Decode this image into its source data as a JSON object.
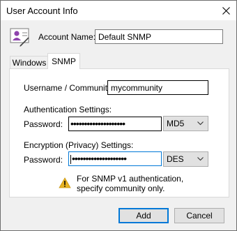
{
  "window": {
    "title": "User Account Info"
  },
  "account": {
    "name_label": "Account Name:",
    "name_value": "Default SNMP"
  },
  "tabs": [
    {
      "label": "Windows"
    },
    {
      "label": "SNMP"
    }
  ],
  "snmp": {
    "community_label": "Username / Community:",
    "community_value": "mycommunity",
    "auth_section": "Authentication Settings:",
    "auth_password_label": "Password:",
    "auth_password_mask": "••••••••••••••••••••",
    "auth_protocol": "MD5",
    "enc_section": "Encryption (Privacy) Settings:",
    "enc_password_label": "Password:",
    "enc_password_mask": "••••••••••••••••••••",
    "enc_protocol": "DES",
    "note_line1": "For SNMP v1 authentication,",
    "note_line2": "specify community only."
  },
  "buttons": {
    "add": "Add",
    "cancel": "Cancel"
  },
  "icons": {
    "avatar": "user-card-icon",
    "warning": "warning-icon",
    "close": "close-icon"
  },
  "colors": {
    "focus": "#0078d7",
    "warning": "#e8b323"
  }
}
